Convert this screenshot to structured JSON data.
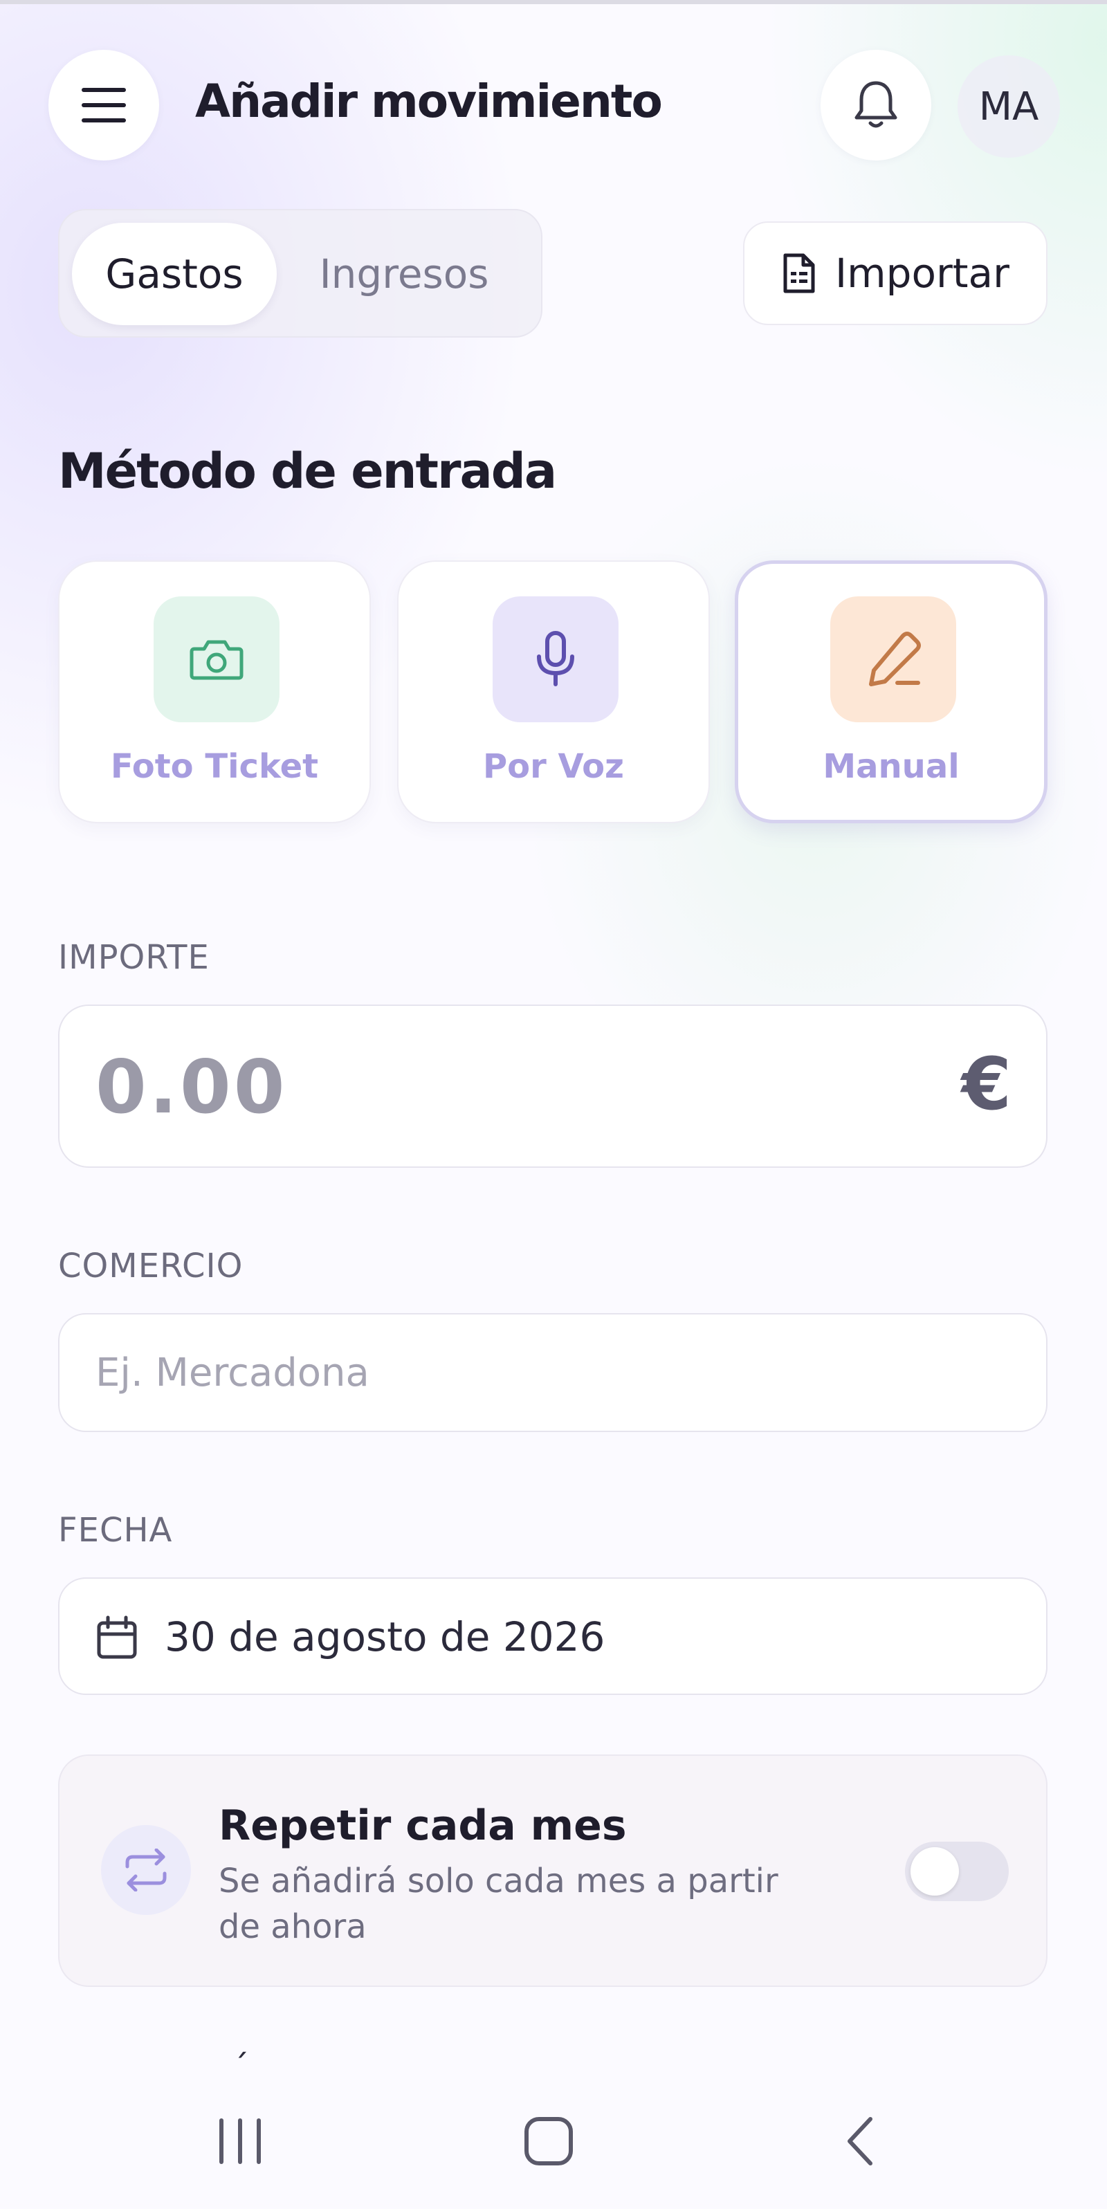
{
  "header": {
    "title": "Añadir movimiento",
    "avatar_initials": "MA",
    "icons": {
      "menu": "menu-icon",
      "notifications": "bell-icon"
    }
  },
  "type_tabs": [
    {
      "label": "Gastos",
      "active": true
    },
    {
      "label": "Ingresos",
      "active": false
    }
  ],
  "import_button": {
    "label": "Importar",
    "icon": "document-icon"
  },
  "input_method": {
    "title": "Método de entrada",
    "options": [
      {
        "label": "Foto Ticket",
        "icon": "camera-icon",
        "color": "#3fa77a",
        "bg": "#e3f5ec",
        "selected": false
      },
      {
        "label": "Por Voz",
        "icon": "microphone-icon",
        "color": "#5d4fae",
        "bg": "#e8e4fa",
        "selected": false
      },
      {
        "label": "Manual",
        "icon": "pencil-icon",
        "color": "#c27a48",
        "bg": "#fde7d6",
        "selected": true
      }
    ]
  },
  "amount": {
    "label": "IMPORTE",
    "placeholder": "0.00",
    "currency": "€"
  },
  "merchant": {
    "label": "COMERCIO",
    "placeholder": "Ej. Mercadona"
  },
  "date": {
    "label": "FECHA",
    "value": "30 de agosto de 2026",
    "icon": "calendar-icon"
  },
  "recurring": {
    "title": "Repetir cada mes",
    "subtitle": "Se añadirá solo cada mes a partir de ahora",
    "enabled": false,
    "icon": "repeat-icon"
  },
  "partial_text": "´",
  "system_nav": {
    "items": [
      "recents-icon",
      "home-icon",
      "back-icon"
    ]
  },
  "colors": {
    "accent": "#a79ddf",
    "title": "#1f1d2c",
    "muted": "#6c6b7d"
  }
}
